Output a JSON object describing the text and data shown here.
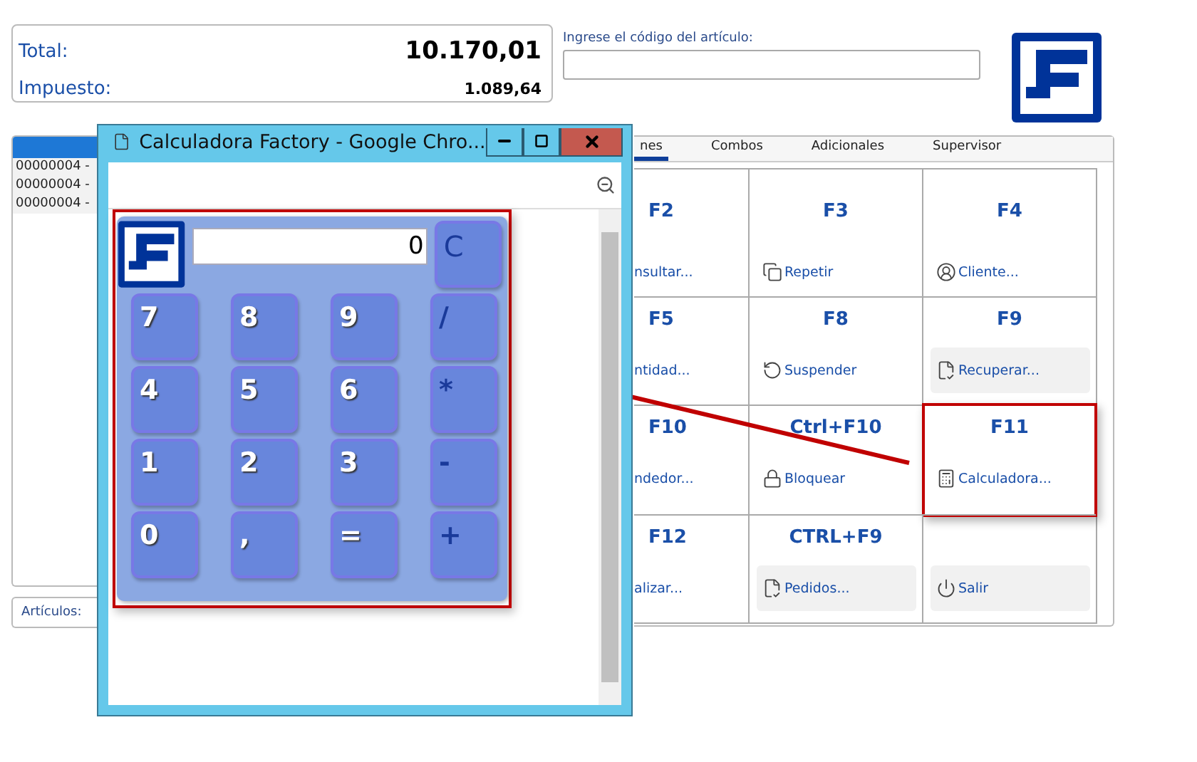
{
  "totals": {
    "total_label": "Total:",
    "total_value": "10.170,01",
    "tax_label": "Impuesto:",
    "tax_value": "1.089,64"
  },
  "article_code": {
    "label": "Ingrese el código del artículo:"
  },
  "items_list": {
    "rows": [
      "00000004 -",
      "00000004 -",
      "00000004 -"
    ]
  },
  "articles_field": {
    "label": "Artículos:"
  },
  "tabs": [
    {
      "label": "nes",
      "selected": true
    },
    {
      "label": "Combos",
      "selected": false
    },
    {
      "label": "Adicionales",
      "selected": false
    },
    {
      "label": "Supervisor",
      "selected": false
    }
  ],
  "functions": [
    {
      "key": "F2",
      "label": "nsultar...",
      "kind": "plain",
      "shaded": false,
      "highlighted": false
    },
    {
      "key": "F3",
      "label": "Repetir",
      "kind": "copy",
      "shaded": false,
      "highlighted": false
    },
    {
      "key": "F4",
      "label": "Cliente...",
      "kind": "user",
      "shaded": false,
      "highlighted": false
    },
    {
      "key": "F5",
      "label": "ntidad...",
      "kind": "plain",
      "shaded": false,
      "highlighted": false
    },
    {
      "key": "F8",
      "label": "Suspender",
      "kind": "suspend",
      "shaded": false,
      "highlighted": false
    },
    {
      "key": "F9",
      "label": "Recuperar...",
      "kind": "document",
      "shaded": true,
      "highlighted": false
    },
    {
      "key": "F10",
      "label": "ndedor...",
      "kind": "plain",
      "shaded": false,
      "highlighted": false
    },
    {
      "key": "Ctrl+F10",
      "label": "Bloquear",
      "kind": "lock",
      "shaded": false,
      "highlighted": false
    },
    {
      "key": "F11",
      "label": "Calculadora...",
      "kind": "calculator",
      "shaded": false,
      "highlighted": true
    },
    {
      "key": "F12",
      "label": "alizar...",
      "kind": "plain",
      "shaded": false,
      "highlighted": false
    },
    {
      "key": "CTRL+F9",
      "label": "Pedidos...",
      "kind": "document",
      "shaded": true,
      "highlighted": false
    },
    {
      "label": "Salir",
      "kind": "power",
      "shaded": true,
      "highlighted": false
    }
  ],
  "popup": {
    "title": "Calculadora Factory - Google Chro...",
    "display": "0",
    "clear": "C",
    "keys": [
      {
        "label": "7",
        "kind": "digit"
      },
      {
        "label": "8",
        "kind": "digit"
      },
      {
        "label": "9",
        "kind": "digit"
      },
      {
        "label": "/",
        "kind": "operator"
      },
      {
        "label": "4",
        "kind": "digit"
      },
      {
        "label": "5",
        "kind": "digit"
      },
      {
        "label": "6",
        "kind": "digit"
      },
      {
        "label": "*",
        "kind": "operator"
      },
      {
        "label": "1",
        "kind": "digit"
      },
      {
        "label": "2",
        "kind": "digit"
      },
      {
        "label": "3",
        "kind": "digit"
      },
      {
        "label": "-",
        "kind": "operator"
      },
      {
        "label": "0",
        "kind": "digit"
      },
      {
        "label": ",",
        "kind": "digit"
      },
      {
        "label": "=",
        "kind": "digit"
      },
      {
        "label": "+",
        "kind": "operator"
      }
    ]
  }
}
